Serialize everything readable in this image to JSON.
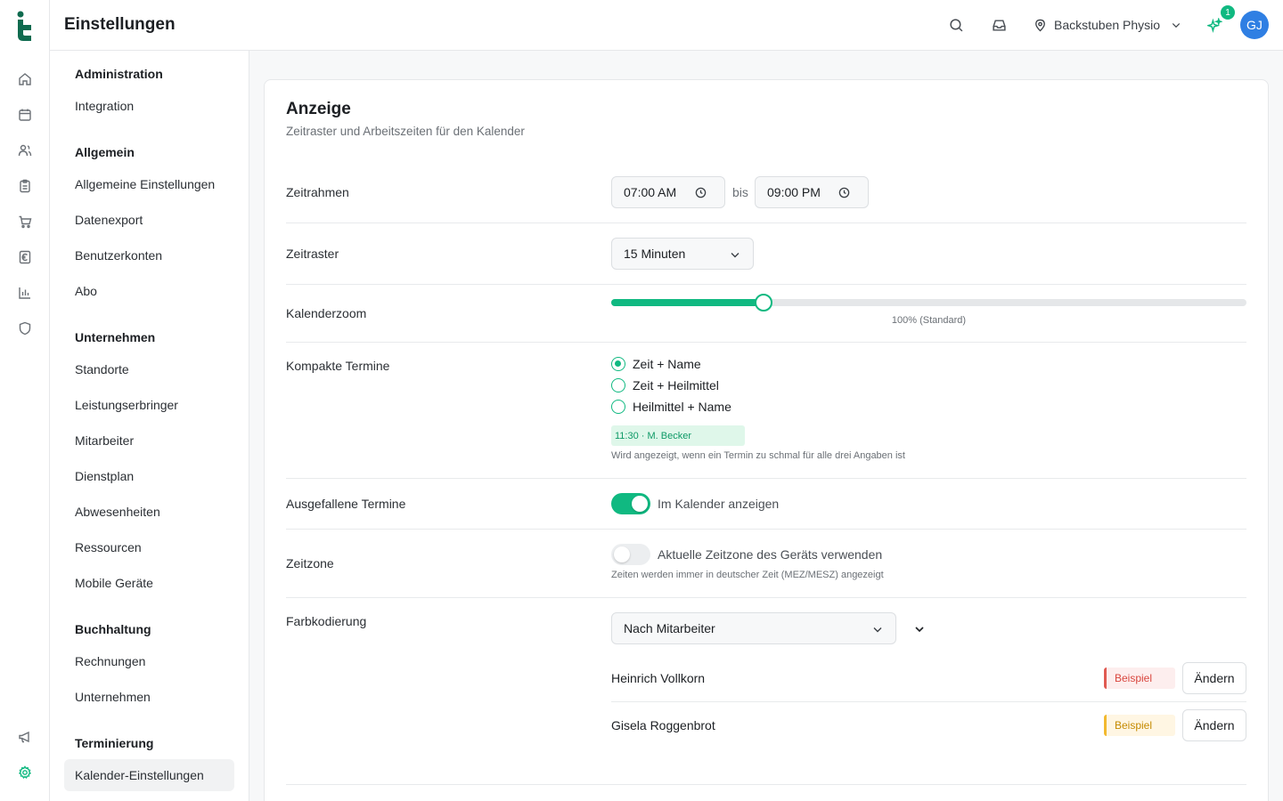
{
  "header": {
    "title": "Einstellungen",
    "location": "Backstuben Physio",
    "notification_count": "1",
    "avatar_initials": "GJ"
  },
  "rail": {
    "icons": [
      "home-icon",
      "calendar-icon",
      "users-icon",
      "clipboard-icon",
      "cart-icon",
      "euro-icon",
      "bar-chart-icon",
      "shield-icon",
      "megaphone-icon",
      "gear-icon"
    ],
    "active": "gear-icon"
  },
  "sidebar": {
    "sections": [
      {
        "title": "Administration",
        "items": [
          "Integration"
        ]
      },
      {
        "title": "Allgemein",
        "items": [
          "Allgemeine Einstellungen",
          "Datenexport",
          "Benutzerkonten",
          "Abo"
        ]
      },
      {
        "title": "Unternehmen",
        "items": [
          "Standorte",
          "Leistungserbringer",
          "Mitarbeiter",
          "Dienstplan",
          "Abwesenheiten",
          "Ressourcen",
          "Mobile Geräte"
        ]
      },
      {
        "title": "Buchhaltung",
        "items": [
          "Rechnungen",
          "Unternehmen"
        ]
      },
      {
        "title": "Terminierung",
        "items": [
          "Kalender-Einstellungen"
        ]
      }
    ],
    "active_item": "Kalender-Einstellungen"
  },
  "card": {
    "title": "Anzeige",
    "subtitle": "Zeitraster und Arbeitszeiten für den Kalender",
    "zeitrahmen": {
      "label": "Zeitrahmen",
      "start": "07:00 AM",
      "between": "bis",
      "end": "09:00 PM"
    },
    "zeitraster": {
      "label": "Zeitraster",
      "value": "15 Minuten"
    },
    "zoom": {
      "label": "Kalenderzoom",
      "caption": "100% (Standard)",
      "fraction": 0.24
    },
    "kompakt": {
      "label": "Kompakte Termine",
      "options": [
        "Zeit + Name",
        "Zeit + Heilmittel",
        "Heilmittel + Name"
      ],
      "selected_index": 0,
      "preview": "11:30 · M. Becker",
      "hint": "Wird angezeigt, wenn ein Termin zu schmal für alle drei Angaben ist"
    },
    "ausgefallen": {
      "label": "Ausgefallene Termine",
      "toggle_label": "Im Kalender anzeigen",
      "on": true
    },
    "zeitzone": {
      "label": "Zeitzone",
      "toggle_label": "Aktuelle Zeitzone des Geräts verwenden",
      "on": false,
      "hint": "Zeiten werden immer in deutscher Zeit (MEZ/MESZ) angezeigt"
    },
    "farbkodierung": {
      "label": "Farbkodierung",
      "value": "Nach Mitarbeiter",
      "employees": [
        {
          "name": "Heinrich Vollkorn",
          "sample": "Beispiel",
          "color": "#e05a52",
          "button": "Ändern"
        },
        {
          "name": "Gisela Roggenbrot",
          "sample": "Beispiel",
          "color": "#f2b92f",
          "button": "Ändern"
        }
      ]
    }
  },
  "colors": {
    "accent": "#10b981",
    "avatar": "#2f7fe3"
  }
}
